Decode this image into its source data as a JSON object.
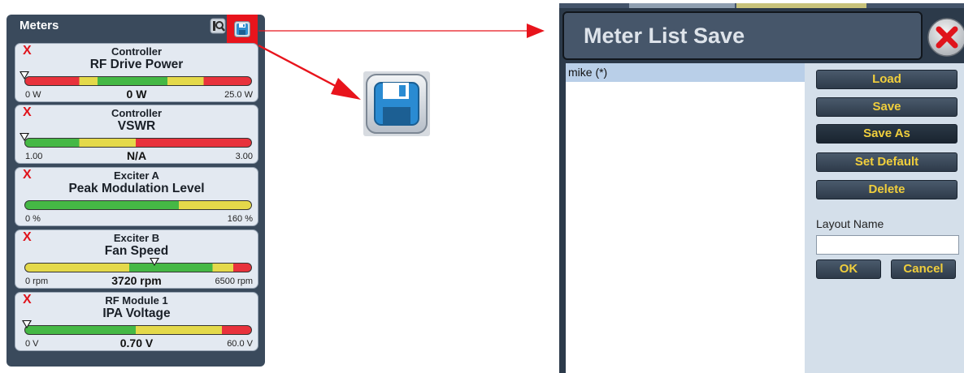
{
  "meters_panel": {
    "title": "Meters",
    "icons": {
      "tune": "search-tune-icon",
      "save": "floppy-save-icon"
    },
    "meters": [
      {
        "close": "X",
        "source": "Controller",
        "parameter": "RF Drive Power",
        "min": "0 W",
        "value": "0 W",
        "max": "25.0 W",
        "marker_fraction": 0
      },
      {
        "close": "X",
        "source": "Controller",
        "parameter": "VSWR",
        "min": "1.00",
        "value": "N/A",
        "max": "3.00",
        "marker_fraction": 0
      },
      {
        "close": "X",
        "source": "Exciter A",
        "parameter": "Peak Modulation Level",
        "min": "0 %",
        "value": "",
        "max": "160 %",
        "marker_fraction": null
      },
      {
        "close": "X",
        "source": "Exciter B",
        "parameter": "Fan Speed",
        "min": "0 rpm",
        "value": "3720 rpm",
        "max": "6500 rpm",
        "marker_fraction": 0.57
      },
      {
        "close": "X",
        "source": "RF Module 1",
        "parameter": "IPA Voltage",
        "min": "0 V",
        "value": "0.70 V",
        "max": "60.0 V",
        "marker_fraction": 0.01
      }
    ]
  },
  "zoomed_icon": "floppy-save-icon",
  "dialog": {
    "title": "Meter List Save",
    "close_icon": "close-x-icon",
    "list_items": [
      "mike (*)"
    ],
    "buttons": {
      "load": "Load",
      "save": "Save",
      "save_as": "Save As",
      "set_default": "Set Default",
      "delete": "Delete",
      "ok": "OK",
      "cancel": "Cancel"
    },
    "layout_name_label": "Layout Name",
    "layout_name_value": ""
  },
  "colors": {
    "panel_bg": "#3a4a5c",
    "highlight_red": "#e8141c",
    "bar_red": "#e8323c",
    "bar_yellow": "#e4d94a",
    "bar_green": "#45b845",
    "button_text": "#f0ce3c"
  }
}
